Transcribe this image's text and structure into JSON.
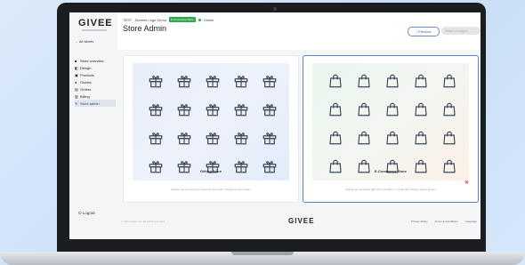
{
  "sidebar": {
    "logo": "GIVEE",
    "all_stores": "← All stores",
    "items": [
      {
        "icon": "■",
        "label": "Store overview"
      },
      {
        "icon": "◧",
        "label": "Design"
      },
      {
        "icon": "▣",
        "label": "Products"
      },
      {
        "icon": "●",
        "label": "Guests"
      },
      {
        "icon": "▤",
        "label": "Orders"
      },
      {
        "icon": "▥",
        "label": "Billing"
      },
      {
        "icon": "✎",
        "label": "Store admin"
      }
    ],
    "logout": "⏻ Logout"
  },
  "header": {
    "breadcrumb": "TEST - Summit Logo Demo",
    "badge": "E-Commerce Store",
    "status": "Online",
    "title": "Store Admin",
    "preview_label": "‹ Preview",
    "disabled_label": "Save changes"
  },
  "cards": [
    {
      "title": "Gifting Store",
      "description": "Guests can choose and customize their gifts. Pricing can be shown.",
      "icon": "gift-icon"
    },
    {
      "title": "E-Commerce Store",
      "description": "Guests can purchase gifts with gift cards or credit card. Pricing will be shown.",
      "icon": "shopping-bag-icon"
    }
  ],
  "footer": {
    "copyright": "© 2024 Givee Inc. All rights reserved.",
    "logo": "GIVEE",
    "links": [
      "Privacy Policy",
      "Terms & Conditions",
      "Language"
    ]
  },
  "colors": {
    "accent": "#5a84c8",
    "online": "#2fa84f",
    "remove": "#dd3333",
    "icon": "#3e4a5c"
  }
}
